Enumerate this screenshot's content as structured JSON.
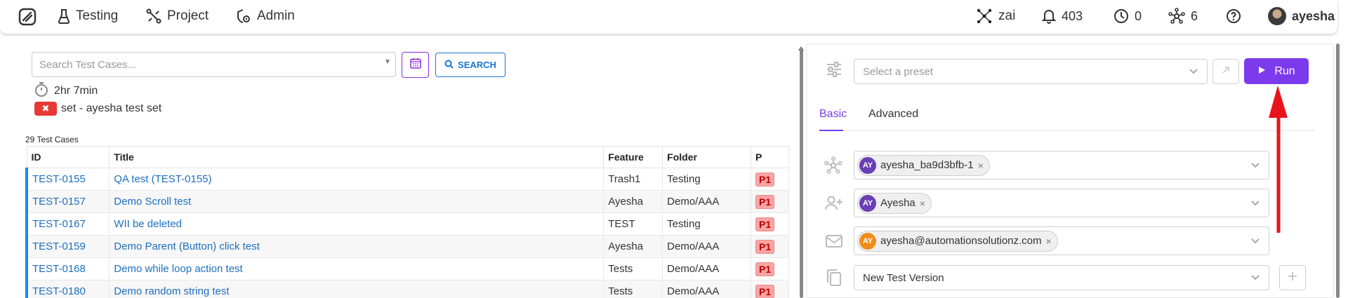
{
  "nav": {
    "items": [
      {
        "label": "Testing",
        "icon": "flask-icon"
      },
      {
        "label": "Project",
        "icon": "project-icon"
      },
      {
        "label": "Admin",
        "icon": "admin-icon"
      }
    ],
    "right": {
      "zai": "zai",
      "notifications": "403",
      "history": "0",
      "connections": "6",
      "user": "ayesha"
    }
  },
  "search": {
    "placeholder": "Search Test Cases...",
    "search_label": "SEARCH",
    "timer": "2hr 7min",
    "set_label": "set - ayesha test set"
  },
  "table": {
    "count": "29 Test Cases",
    "headers": [
      "ID",
      "Title",
      "Feature",
      "Folder",
      "P"
    ],
    "rows": [
      {
        "id": "TEST-0155",
        "title": "QA test (TEST-0155)",
        "feature": "Trash1",
        "folder": "Testing",
        "p": "P1"
      },
      {
        "id": "TEST-0157",
        "title": "Demo Scroll test",
        "feature": "Ayesha",
        "folder": "Demo/AAA",
        "p": "P1"
      },
      {
        "id": "TEST-0167",
        "title": "WII be deleted",
        "feature": "TEST",
        "folder": "Testing",
        "p": "P1"
      },
      {
        "id": "TEST-0159",
        "title": "Demo Parent (Button) click test",
        "feature": "Ayesha",
        "folder": "Demo/AAA",
        "p": "P1"
      },
      {
        "id": "TEST-0168",
        "title": "Demo while loop action test",
        "feature": "Tests",
        "folder": "Demo/AAA",
        "p": "P1"
      },
      {
        "id": "TEST-0180",
        "title": "Demo random string test",
        "feature": "Tests",
        "folder": "Demo/AAA",
        "p": "P1"
      }
    ]
  },
  "panel": {
    "preset_placeholder": "Select a preset",
    "run_label": "Run",
    "tabs": [
      "Basic",
      "Advanced"
    ],
    "agent_chip": {
      "initials": "AY",
      "label": "ayesha_ba9d3bfb-1"
    },
    "user_chip": {
      "initials": "AY",
      "label": "Ayesha"
    },
    "email_chip": {
      "initials": "AY",
      "label": "ayesha@automationsolutionz.com"
    },
    "version": "New Test Version"
  },
  "colors": {
    "accent": "#7c3aed",
    "link": "#1e6fbf",
    "priority": "#f8a5a5",
    "annotation": "#e8141b"
  }
}
